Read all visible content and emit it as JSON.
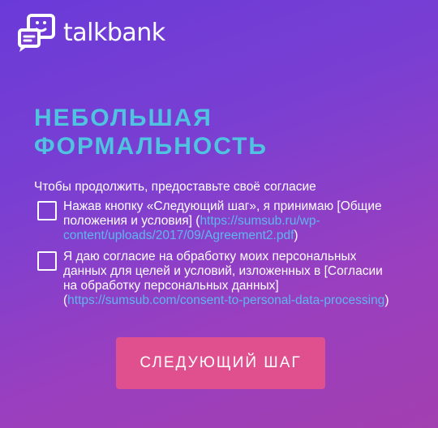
{
  "logo": {
    "text": "talkbank",
    "icon": "chat-bubbles-logo-icon"
  },
  "heading": {
    "line1": "НЕБОЛЬШАЯ",
    "line2": "ФОРМАЛЬНОСТЬ"
  },
  "intro_text": "Чтобы продолжить, предоставьте своё согласие",
  "consents": [
    {
      "text": "Нажав кнопку «Следующий шаг», я принимаю [Общие положения и условия] (",
      "link": "https://sumsub.ru/wp-content/uploads/2017/09/Agreement2.pdf",
      "suffix": ")",
      "checked": false
    },
    {
      "text": "Я даю согласие на обработку моих персональных данных для целей и условий, изложенных в [Согласии на обработку персональных данных] (",
      "link": "https://sumsub.com/consent-to-personal-data-processing",
      "suffix": ")",
      "checked": false
    }
  ],
  "next_button_label": "СЛЕДУЮЩИЙ ШАГ",
  "colors": {
    "heading": "#4fc3e0",
    "link": "#5fb6ee",
    "button": "#e0508e",
    "background_start": "#6a3ad8",
    "background_end": "#a23fb0"
  }
}
